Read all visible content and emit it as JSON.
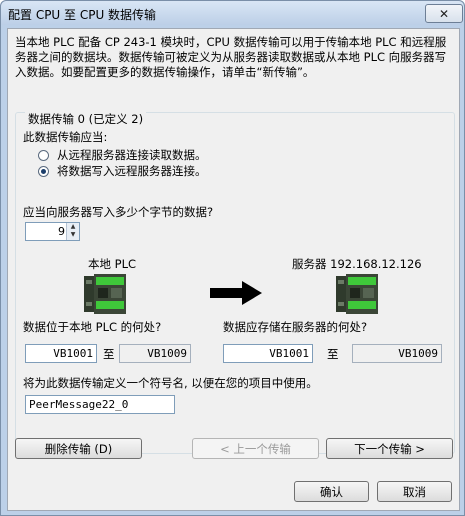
{
  "window": {
    "title": "配置 CPU 至 CPU 数据传输",
    "close_glyph": "✕"
  },
  "intro_text": "当本地 PLC 配备 CP 243-1  模块时，CPU 数据传输可以用于传输本地 PLC 和远程服务器之间的数据块。数据传输可被定义为从服务器读取数据或从本地 PLC 向服务器写入数据。如要配置更多的数据传输操作，请单击“新传输”。",
  "group": {
    "title": "数据传输 0 (已定义 2)",
    "direction_label": "此数据传输应当:",
    "options": [
      {
        "label": "从远程服务器连接读取数据。",
        "selected": false
      },
      {
        "label": "将数据写入远程服务器连接。",
        "selected": true
      }
    ],
    "bytes_question": "应当向服务器写入多少个字节的数据?",
    "bytes_value": "9",
    "local_label": "本地 PLC",
    "server_label": "服务器 192.168.12.126",
    "local_question": "数据位于本地 PLC 的何处?",
    "server_question": "数据应存储在服务器的何处?",
    "local_start": "VB1001",
    "local_end": "VB1009",
    "server_start": "VB1001",
    "server_end": "VB1009",
    "to_label": "至",
    "symbol_prompt": "将为此数据传输定义一个符号名, 以便在您的项目中使用。",
    "symbol_value": "PeerMessage22_0"
  },
  "buttons": {
    "delete": "删除传输 (D)",
    "prev": "< 上一个传输",
    "next": "下一个传输 >",
    "ok": "确认",
    "cancel": "取消"
  },
  "colors": {
    "plc_body": "#2f3a2c",
    "plc_green": "#3fc83a",
    "arrow": "#000000"
  }
}
